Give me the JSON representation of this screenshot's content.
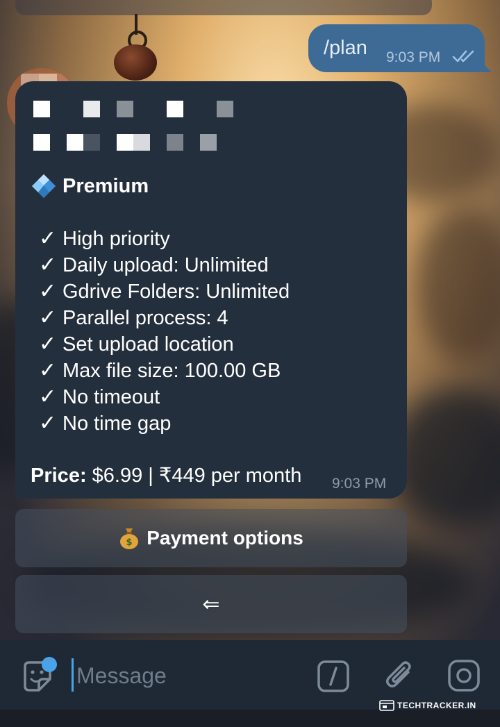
{
  "outgoing_message": {
    "text": "/plan",
    "time": "9:03 PM",
    "status_icon": "double-check-icon"
  },
  "incoming_message": {
    "plan_icon": "diamond-icon",
    "plan_name": "Premium",
    "check_glyph": "✓",
    "features": [
      "High priority",
      "Daily upload: Unlimited",
      "Gdrive Folders: Unlimited",
      "Parallel process: 4",
      "Set upload location",
      "Max file size: 100.00 GB",
      "No timeout",
      "No time gap"
    ],
    "price_label": "Price:",
    "price_value": "$6.99 | ₹449 per month",
    "time": "9:03 PM"
  },
  "keyboard_buttons": {
    "payment": {
      "icon": "money-bag-icon",
      "label": "Payment options"
    },
    "back": {
      "label": "⇐"
    }
  },
  "input_bar": {
    "placeholder": "Message",
    "icons": [
      "sticker-emoji-icon",
      "bot-command-icon",
      "paperclip-icon",
      "camera-icon"
    ]
  },
  "watermark": {
    "text": "TechTracker.in",
    "display_text": "TECHTRACKER.IN"
  },
  "colors": {
    "outgoing_bubble": "#3e6b96",
    "incoming_bubble": "#242f3d",
    "accent": "#4aa3e8",
    "input_bar": "#1f2835"
  }
}
